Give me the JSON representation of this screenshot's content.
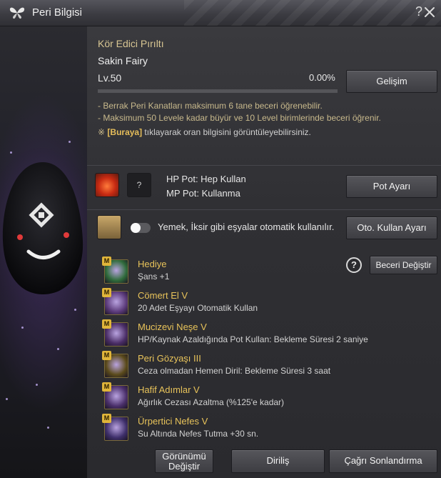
{
  "window": {
    "title": "Peri Bilgisi",
    "help_glyph": "?",
    "close_glyph": "✕"
  },
  "fairy": {
    "name": "Kör Edici Pırıltı",
    "subtitle": "Sakin Fairy",
    "level_label": "Lv.50",
    "progress_text": "0.00%",
    "progress_fraction": 0.0,
    "info_lines": [
      "- Berrak Peri Kanatları maksimum 6 tane beceri öğrenebilir.",
      "- Maksimum 50 Levele kadar büyür ve 10 Level birimlerinde beceri öğrenir."
    ],
    "note_mark": "※",
    "note_link": "[Buraya]",
    "note_text": " tıklayarak oran bilgisini görüntüleyebilirsiniz."
  },
  "buttons": {
    "develop": "Gelişim",
    "pot_settings": "Pot Ayarı",
    "auto_use_settings": "Oto. Kullan Ayarı",
    "change_skill": "Beceri Değiştir",
    "change_look_line1": "Görünümü",
    "change_look_line2": "Değiştir",
    "revive": "Diriliş",
    "end_summon": "Çağrı Sonlandırma"
  },
  "potion": {
    "slot_placeholder": "?",
    "hp_line": "HP Pot: Hep Kullan",
    "mp_line": "MP Pot: Kullanma"
  },
  "food": {
    "toggle_on": false,
    "text": "Yemek, İksir gibi eşyalar otomatik kullanılır."
  },
  "skill_help_glyph": "?",
  "skills": [
    {
      "badge": "M",
      "name": "Hediye",
      "desc": "Şans +1",
      "icon": "clover-icon",
      "color": "#2f6b3a"
    },
    {
      "badge": "M",
      "name": "Cömert El V",
      "desc": "20 Adet Eşyayı Otomatik Kullan",
      "icon": "fairy-wing-icon",
      "color": "#5b3a7a"
    },
    {
      "badge": "M",
      "name": "Mucizevi Neşe V",
      "desc": "HP/Kaynak Azaldığında Pot Kullan: Bekleme Süresi 2 saniye",
      "icon": "potion-bottle-icon",
      "color": "#4a2d66"
    },
    {
      "badge": "M",
      "name": "Peri Gözyaşı III",
      "desc": "Ceza olmadan Hemen Diril: Bekleme Süresi 3 saat",
      "icon": "chalice-icon",
      "color": "#5a4a1a"
    },
    {
      "badge": "M",
      "name": "Hafif Adımlar V",
      "desc": "Ağırlık Cezası Azaltma (%125'e kadar)",
      "icon": "feather-bottle-icon",
      "color": "#4a2f6a"
    },
    {
      "badge": "M",
      "name": "Ürpertici Nefes V",
      "desc": "Su Altında Nefes Tutma +30 sn.",
      "icon": "breath-bubble-icon",
      "color": "#3e2f6a"
    }
  ]
}
